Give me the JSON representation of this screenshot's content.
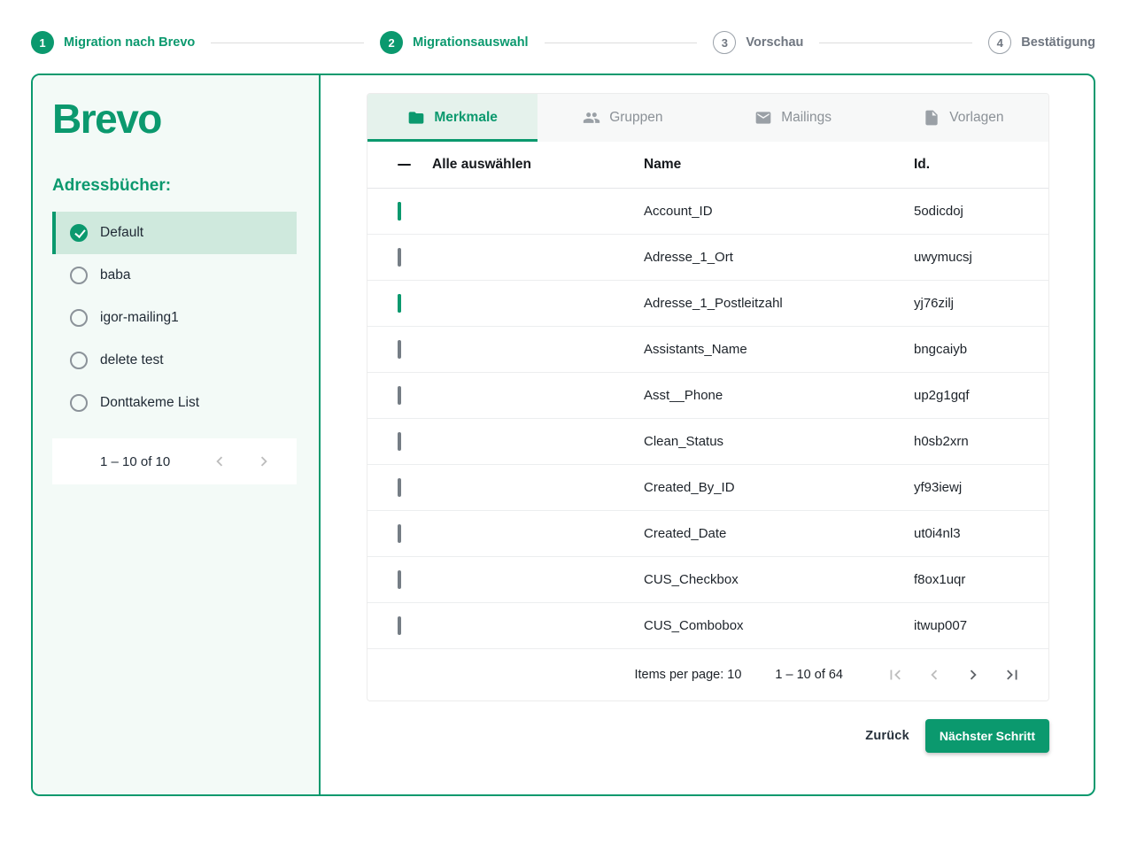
{
  "accent_color": "#0b996e",
  "stepper": {
    "steps": [
      {
        "number": "1",
        "label": "Migration nach Brevo",
        "state": "active"
      },
      {
        "number": "2",
        "label": "Migrationsauswahl",
        "state": "active"
      },
      {
        "number": "3",
        "label": "Vorschau",
        "state": "inactive"
      },
      {
        "number": "4",
        "label": "Bestätigung",
        "state": "inactive"
      }
    ]
  },
  "sidebar": {
    "logo": "Brevo",
    "heading": "Adressbücher:",
    "address_books": [
      {
        "label": "Default",
        "selected": true
      },
      {
        "label": "baba",
        "selected": false
      },
      {
        "label": "igor-mailing1",
        "selected": false
      },
      {
        "label": "delete test",
        "selected": false
      },
      {
        "label": "Donttakeme List",
        "selected": false
      }
    ],
    "pagination": {
      "range": "1 – 10 of 10"
    }
  },
  "tabs": [
    {
      "label": "Merkmale",
      "icon": "folder-icon",
      "active": true
    },
    {
      "label": "Gruppen",
      "icon": "people-icon",
      "active": false
    },
    {
      "label": "Mailings",
      "icon": "mail-icon",
      "active": false
    },
    {
      "label": "Vorlagen",
      "icon": "file-icon",
      "active": false
    }
  ],
  "table": {
    "select_all_label": "Alle auswählen",
    "columns": {
      "name": "Name",
      "id": "Id."
    },
    "rows": [
      {
        "name": "Account_ID",
        "id": "5odicdoj",
        "checked": true
      },
      {
        "name": "Adresse_1_Ort",
        "id": "uwymucsj",
        "checked": false
      },
      {
        "name": "Adresse_1_Postleitzahl",
        "id": "yj76zilj",
        "checked": true
      },
      {
        "name": "Assistants_Name",
        "id": "bngcaiyb",
        "checked": false
      },
      {
        "name": "Asst__Phone",
        "id": "up2g1gqf",
        "checked": false
      },
      {
        "name": "Clean_Status",
        "id": "h0sb2xrn",
        "checked": false
      },
      {
        "name": "Created_By_ID",
        "id": "yf93iewj",
        "checked": false
      },
      {
        "name": "Created_Date",
        "id": "ut0i4nl3",
        "checked": false
      },
      {
        "name": "CUS_Checkbox",
        "id": "f8ox1uqr",
        "checked": false
      },
      {
        "name": "CUS_Combobox",
        "id": "itwup007",
        "checked": false
      }
    ],
    "pagination": {
      "items_per_page_label": "Items per page: 10",
      "range": "1 – 10 of 64"
    }
  },
  "footer": {
    "back_label": "Zurück",
    "next_label": "Nächster Schritt"
  }
}
